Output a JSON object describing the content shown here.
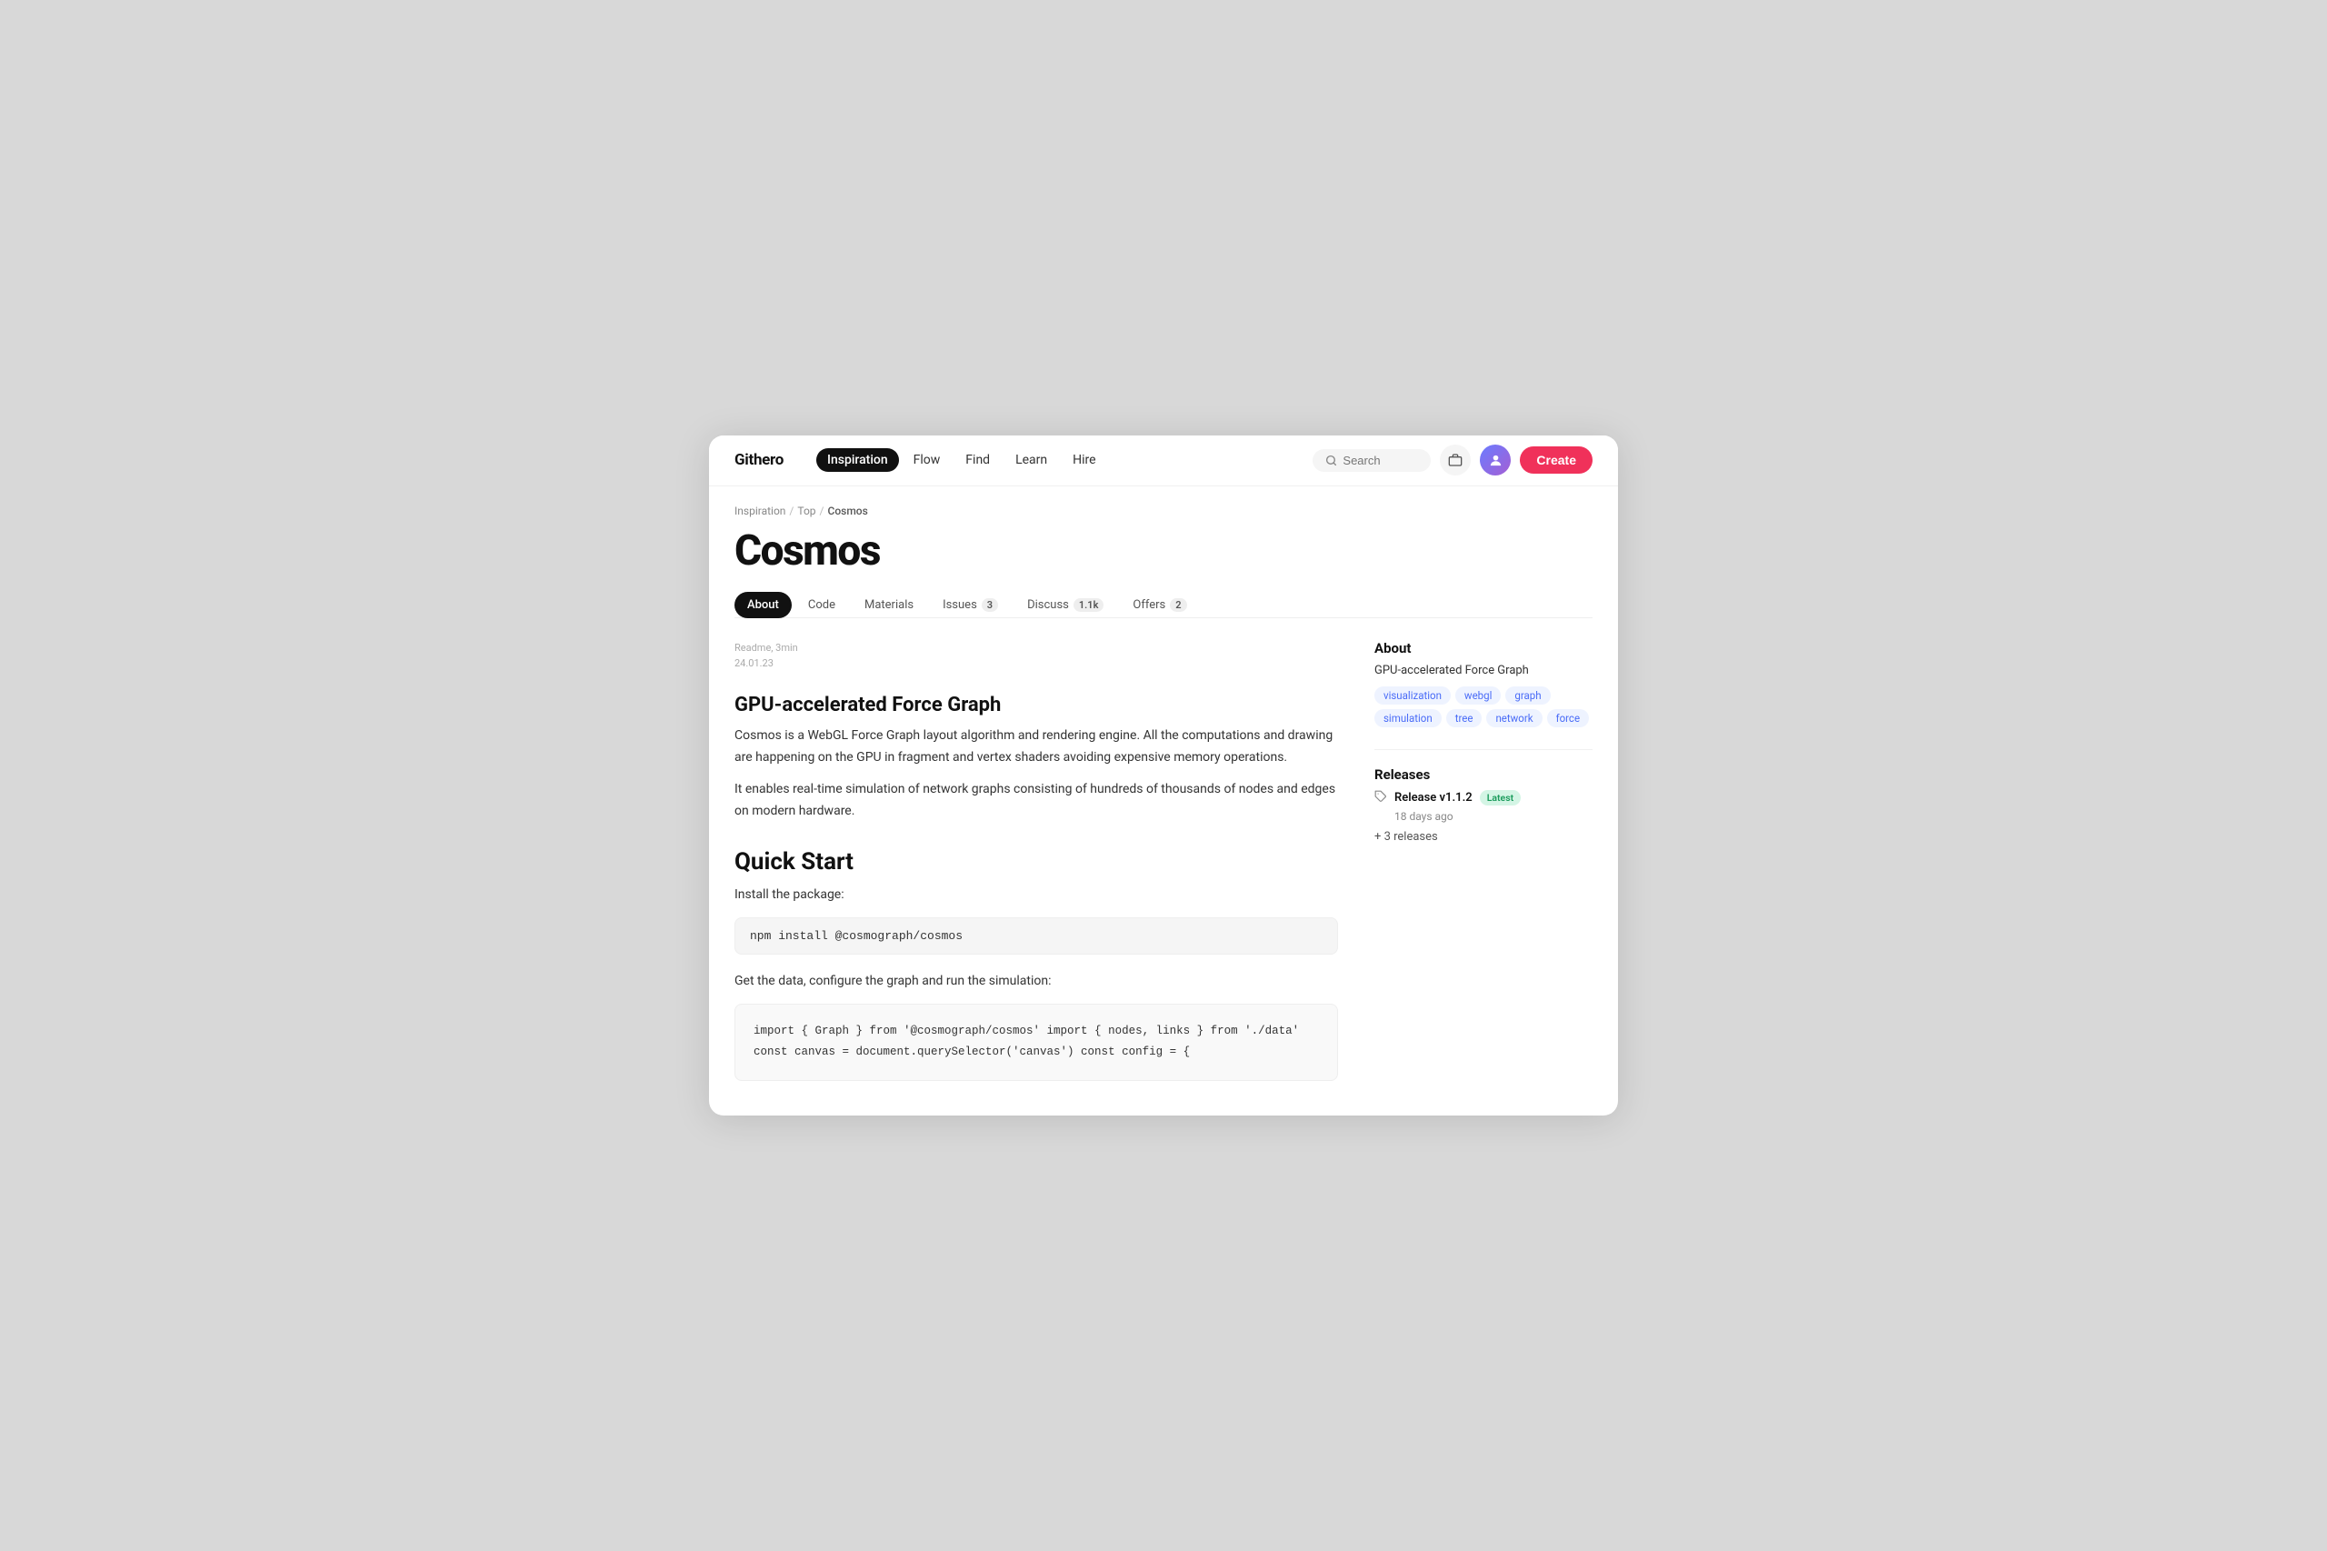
{
  "logo": "Githero",
  "nav": {
    "links": [
      {
        "label": "Inspiration",
        "active": true
      },
      {
        "label": "Flow",
        "active": false
      },
      {
        "label": "Find",
        "active": false
      },
      {
        "label": "Learn",
        "active": false
      },
      {
        "label": "Hire",
        "active": false
      }
    ],
    "search_placeholder": "Search",
    "create_label": "Create"
  },
  "breadcrumb": {
    "items": [
      "Inspiration",
      "Top",
      "Cosmos"
    ],
    "separators": [
      "/",
      "/"
    ]
  },
  "page_title": "Cosmos",
  "tabs": [
    {
      "label": "About",
      "active": true,
      "badge": null
    },
    {
      "label": "Code",
      "active": false,
      "badge": null
    },
    {
      "label": "Materials",
      "active": false,
      "badge": null
    },
    {
      "label": "Issues",
      "active": false,
      "badge": "3"
    },
    {
      "label": "Discuss",
      "active": false,
      "badge": "1.1k"
    },
    {
      "label": "Offers",
      "active": false,
      "badge": "2",
      "badge_pink": true
    }
  ],
  "doc_meta": {
    "label": "Readme, 3min",
    "date": "24.01.23"
  },
  "content": {
    "heading": "GPU-accelerated Force Graph",
    "para1": "Cosmos is a WebGL Force Graph layout algorithm and rendering engine. All the computations and drawing are happening on the GPU in fragment and vertex shaders avoiding expensive memory operations.",
    "para2": "It enables real-time simulation of network graphs consisting of hundreds of thousands of nodes and edges on modern hardware.",
    "quick_start_title": "Quick Start",
    "install_label": "Install the package:",
    "install_cmd": "npm install @cosmograph/cosmos",
    "get_data_label": "Get the data, configure the graph and run the simulation:",
    "code_block": "import { Graph } from '@cosmograph/cosmos'\nimport { nodes, links } from './data'\n\nconst canvas = document.querySelector('canvas')\nconst config = {"
  },
  "sidebar": {
    "about_title": "About",
    "about_subtitle": "GPU-accelerated Force Graph",
    "tags": [
      "visualization",
      "webgl",
      "graph",
      "simulation",
      "tree",
      "network",
      "force"
    ],
    "releases_title": "Releases",
    "release": {
      "name": "Release v1.1.2",
      "badge": "Latest",
      "date": "18 days ago"
    },
    "more_releases": "+ 3 releases"
  }
}
